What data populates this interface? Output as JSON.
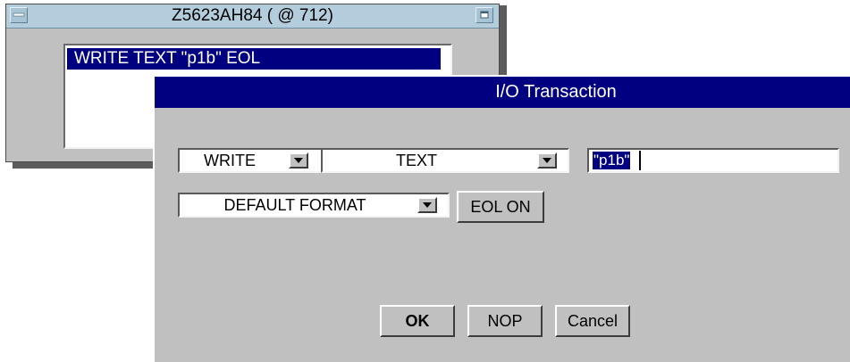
{
  "object_window": {
    "title": "Z5623AH84 ( @ 712)",
    "transactions": [
      "WRITE TEXT \"p1b\" EOL"
    ]
  },
  "dialog": {
    "title": "I/O Transaction",
    "action_select": {
      "value": "WRITE"
    },
    "type_select": {
      "value": "TEXT"
    },
    "expression_field": {
      "value": "\"p1b\""
    },
    "format_select": {
      "value": "DEFAULT FORMAT"
    },
    "eol_button": "EOL ON",
    "ok_button": "OK",
    "nop_button": "NOP",
    "cancel_button": "Cancel"
  },
  "colors": {
    "dialog_title_bg": "#000080",
    "selection_bg": "#000080",
    "window_titlebar_bg": "#b4cddc",
    "panel_bg": "#c0c0c0"
  },
  "icons": [
    "minimize-icon",
    "maximize-icon",
    "dropdown-arrow-icon"
  ]
}
